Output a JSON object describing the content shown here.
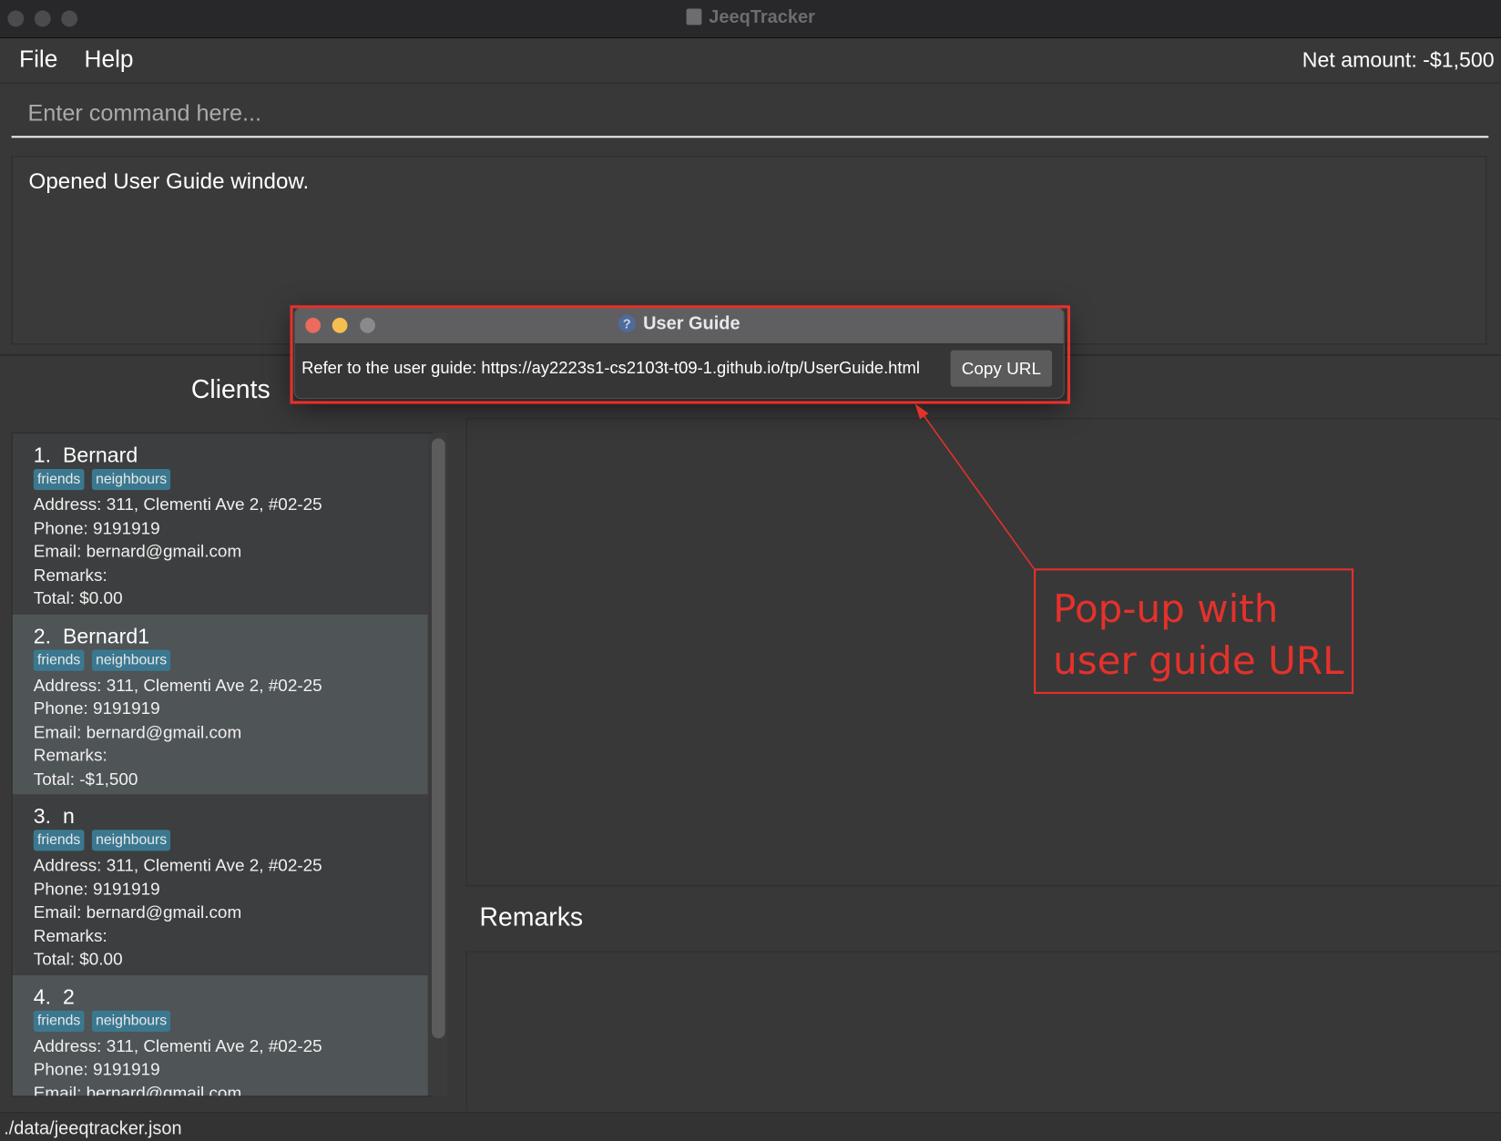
{
  "window": {
    "title": "JeeqTracker"
  },
  "menu": {
    "items": [
      "File",
      "Help"
    ],
    "net_amount": "Net amount: -$1,500"
  },
  "command": {
    "placeholder": "Enter command here...",
    "value": ""
  },
  "result": {
    "text": "Opened User Guide window."
  },
  "clients": {
    "title": "Clients",
    "items": [
      {
        "index": "1.",
        "name": "Bernard",
        "tags": [
          "friends",
          "neighbours"
        ],
        "address": "Address: 311, Clementi Ave 2, #02-25",
        "phone": "Phone: 9191919",
        "email": "Email: bernard@gmail.com",
        "remarks": "Remarks:",
        "total": "Total: $0.00"
      },
      {
        "index": "2.",
        "name": "Bernard1",
        "tags": [
          "friends",
          "neighbours"
        ],
        "address": "Address: 311, Clementi Ave 2, #02-25",
        "phone": "Phone: 9191919",
        "email": "Email: bernard@gmail.com",
        "remarks": "Remarks:",
        "total": "Total: -$1,500"
      },
      {
        "index": "3.",
        "name": "n",
        "tags": [
          "friends",
          "neighbours"
        ],
        "address": "Address: 311, Clementi Ave 2, #02-25",
        "phone": "Phone: 9191919",
        "email": "Email: bernard@gmail.com",
        "remarks": "Remarks:",
        "total": "Total: $0.00"
      },
      {
        "index": "4.",
        "name": "2",
        "tags": [
          "friends",
          "neighbours"
        ],
        "address": "Address: 311, Clementi Ave 2, #02-25",
        "phone": "Phone: 9191919",
        "email": "Email: bernard@gmail.com",
        "remarks": "",
        "total": ""
      }
    ]
  },
  "remarks": {
    "title": "Remarks"
  },
  "status": {
    "path": "./data/jeeqtracker.json"
  },
  "popup": {
    "title": "User Guide",
    "icon": "question-icon",
    "text": "Refer to the user guide: https://ay2223s1-cs2103t-t09-1.github.io/tp/UserGuide.html",
    "copy_label": "Copy URL"
  },
  "annotation": {
    "line1": "Pop-up with",
    "line2": "user guide URL",
    "color": "#e5312b"
  },
  "colors": {
    "tag": "#3b7890",
    "background": "#383838",
    "selected_card": "#4f5457"
  }
}
